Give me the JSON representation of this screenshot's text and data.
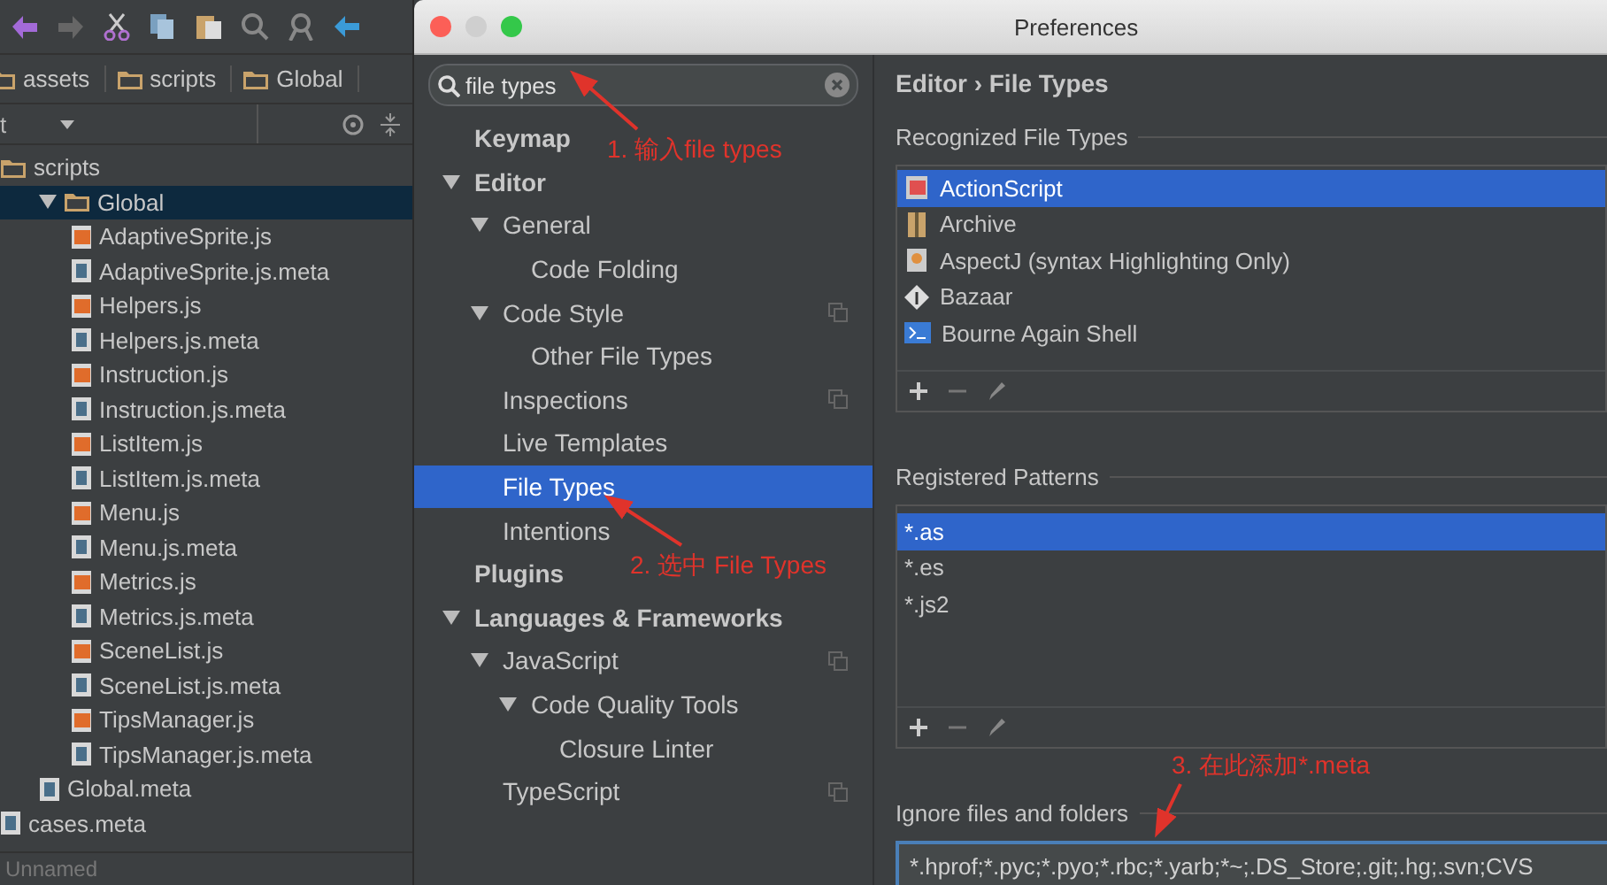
{
  "project": {
    "breadcrumb": [
      "assets",
      "scripts",
      "Global"
    ],
    "view_label": "t",
    "tree": [
      {
        "name": "scripts",
        "kind": "folder",
        "selected": false,
        "children": [
          {
            "name": "Global",
            "kind": "folder",
            "expanded": true,
            "selected": true,
            "children": [
              {
                "name": "AdaptiveSprite.js",
                "kind": "js",
                "selected": false
              },
              {
                "name": "AdaptiveSprite.js.meta",
                "kind": "meta",
                "selected": false
              },
              {
                "name": "Helpers.js",
                "kind": "js",
                "selected": false
              },
              {
                "name": "Helpers.js.meta",
                "kind": "meta",
                "selected": false
              },
              {
                "name": "Instruction.js",
                "kind": "js",
                "selected": false
              },
              {
                "name": "Instruction.js.meta",
                "kind": "meta",
                "selected": false
              },
              {
                "name": "ListItem.js",
                "kind": "js",
                "selected": false
              },
              {
                "name": "ListItem.js.meta",
                "kind": "meta",
                "selected": false
              },
              {
                "name": "Menu.js",
                "kind": "js",
                "selected": false
              },
              {
                "name": "Menu.js.meta",
                "kind": "meta",
                "selected": false
              },
              {
                "name": "Metrics.js",
                "kind": "js",
                "selected": false
              },
              {
                "name": "Metrics.js.meta",
                "kind": "meta",
                "selected": false
              },
              {
                "name": "SceneList.js",
                "kind": "js",
                "selected": false
              },
              {
                "name": "SceneList.js.meta",
                "kind": "meta",
                "selected": false
              },
              {
                "name": "TipsManager.js",
                "kind": "js",
                "selected": false
              },
              {
                "name": "TipsManager.js.meta",
                "kind": "meta",
                "selected": false
              }
            ]
          },
          {
            "name": "Global.meta",
            "kind": "meta",
            "selected": false
          }
        ]
      },
      {
        "name": "cases.meta",
        "kind": "meta",
        "selected": false
      }
    ],
    "status": "Unnamed"
  },
  "window": {
    "title": "Preferences"
  },
  "search": {
    "value": "file types"
  },
  "nav": [
    {
      "label": "Keymap",
      "selected": false
    },
    {
      "label": "Editor",
      "expanded": true,
      "selected": false,
      "children": [
        {
          "label": "General",
          "expanded": true,
          "selected": false,
          "children": [
            {
              "label": "Code Folding",
              "selected": false
            }
          ]
        },
        {
          "label": "Code Style",
          "expanded": true,
          "selected": false,
          "project": true,
          "children": [
            {
              "label": "Other File Types",
              "selected": false
            }
          ]
        },
        {
          "label": "Inspections",
          "selected": false,
          "project": true
        },
        {
          "label": "Live Templates",
          "selected": false
        },
        {
          "label": "File Types",
          "selected": true
        },
        {
          "label": "Intentions",
          "selected": false
        }
      ]
    },
    {
      "label": "Plugins",
      "selected": false
    },
    {
      "label": "Languages & Frameworks",
      "expanded": true,
      "selected": false,
      "children": [
        {
          "label": "JavaScript",
          "expanded": true,
          "selected": false,
          "project": true,
          "children": [
            {
              "label": "Code Quality Tools",
              "expanded": true,
              "selected": false,
              "children": [
                {
                  "label": "Closure Linter",
                  "selected": false
                }
              ]
            }
          ]
        },
        {
          "label": "TypeScript",
          "selected": false,
          "project": true
        }
      ]
    }
  ],
  "content": {
    "breadcrumb": "Editor › File Types",
    "recognized": {
      "label": "Recognized File Types",
      "items": [
        {
          "name": "ActionScript",
          "kind": "actionscript",
          "selected": true
        },
        {
          "name": "Archive",
          "kind": "archive",
          "selected": false
        },
        {
          "name": "AspectJ (syntax Highlighting Only)",
          "kind": "aspectj",
          "selected": false
        },
        {
          "name": "Bazaar",
          "kind": "bazaar",
          "selected": false
        },
        {
          "name": "Bourne Again Shell",
          "kind": "shell",
          "selected": false
        }
      ]
    },
    "patterns": {
      "label": "Registered Patterns",
      "items": [
        {
          "name": "*.as",
          "selected": true
        },
        {
          "name": "*.es",
          "selected": false
        },
        {
          "name": "*.js2",
          "selected": false
        }
      ]
    },
    "ignore": {
      "label": "Ignore files and folders",
      "value": "*.hprof;*.pyc;*.pyo;*.rbc;*.yarb;*~;.DS_Store;.git;.hg;.svn;CVS"
    }
  },
  "annotations": [
    {
      "text": "1. 输入file types"
    },
    {
      "text": "2. 选中 File Types"
    },
    {
      "text": "3. 在此添加*.meta"
    }
  ]
}
